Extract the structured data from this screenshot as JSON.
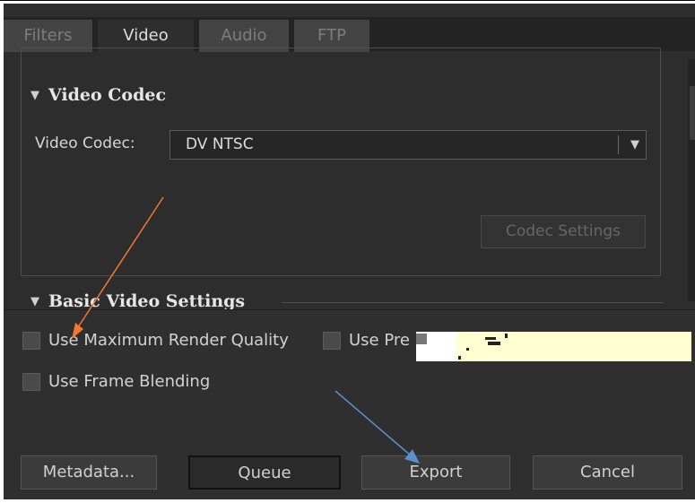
{
  "tabs": [
    {
      "label": "Filters",
      "active": false
    },
    {
      "label": "Video",
      "active": true
    },
    {
      "label": "Audio",
      "active": false
    },
    {
      "label": "FTP",
      "active": false
    }
  ],
  "video_codec_section": {
    "title": "Video Codec",
    "codec_label": "Video Codec:",
    "codec_value": "DV NTSC",
    "codec_settings_button": "Codec Settings"
  },
  "basic_video_section": {
    "title": "Basic Video Settings"
  },
  "options": {
    "max_render_quality": "Use Maximum Render Quality",
    "use_previews_partial": "Use Pre",
    "frame_blending": "Use Frame Blending"
  },
  "buttons": {
    "metadata": "Metadata...",
    "queue": "Queue",
    "export": "Export",
    "cancel": "Cancel"
  },
  "colors": {
    "panel_bg": "#2e2e2e",
    "annotation_orange": "#f07830",
    "annotation_blue": "#5b8fd0",
    "redaction_yellow": "#ffffd2"
  }
}
